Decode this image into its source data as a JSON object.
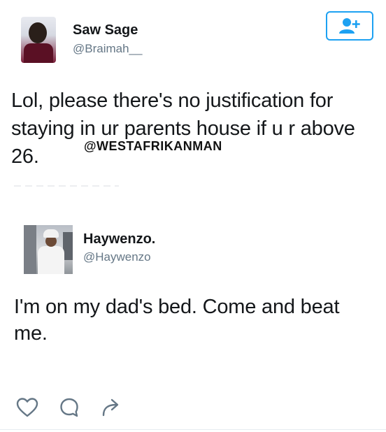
{
  "tweet1": {
    "display_name": "Saw Sage",
    "handle": "@Braimah__",
    "text": "Lol, please there's no justification for staying in ur parents house if u r above 26."
  },
  "watermark": "@WESTAFRIKANMAN",
  "tweet2": {
    "display_name": "Haywenzo.",
    "handle": "@Haywenzo",
    "text": "I'm on my dad's bed. Come and beat me."
  },
  "icons": {
    "follow": "add-user-icon",
    "like": "heart-icon",
    "reply": "reply-icon",
    "retweet": "share-arrow-icon"
  },
  "colors": {
    "accent": "#1da1f2",
    "text": "#14171a",
    "muted": "#657786"
  }
}
